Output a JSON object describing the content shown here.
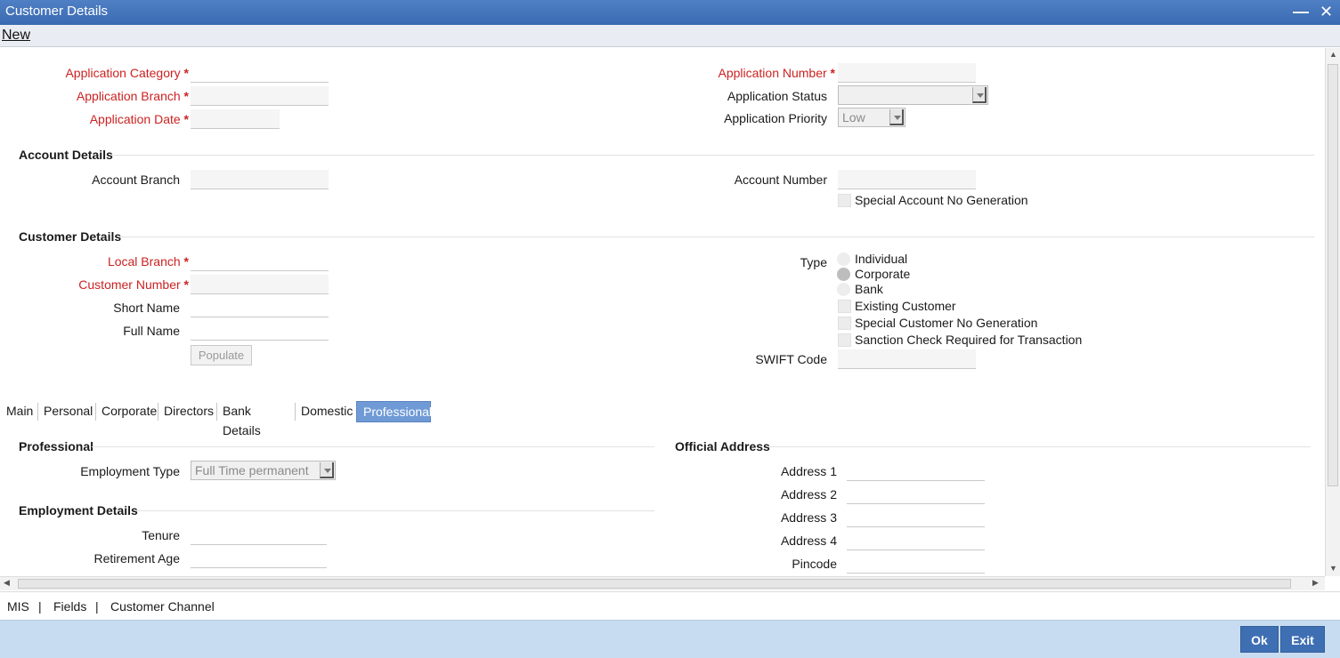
{
  "window": {
    "title": "Customer Details"
  },
  "menu": {
    "new_label": "New"
  },
  "application": {
    "category_label": "Application Category",
    "branch_label": "Application Branch",
    "date_label": "Application Date",
    "number_label": "Application Number",
    "status_label": "Application Status",
    "status_value": "",
    "priority_label": "Application Priority",
    "priority_value": "Low"
  },
  "account": {
    "section_title": "Account Details",
    "branch_label": "Account Branch",
    "number_label": "Account Number",
    "special_no_label": "Special Account No Generation"
  },
  "customer": {
    "section_title": "Customer Details",
    "local_branch_label": "Local Branch",
    "customer_number_label": "Customer Number",
    "short_name_label": "Short Name",
    "full_name_label": "Full Name",
    "populate_label": "Populate",
    "type_label": "Type",
    "type_options": [
      "Individual",
      "Corporate",
      "Bank"
    ],
    "type_selected": "Corporate",
    "existing_customer_label": "Existing Customer",
    "special_customer_no_label": "Special Customer No Generation",
    "sanction_check_label": "Sanction Check Required for Transaction",
    "swift_label": "SWIFT Code"
  },
  "tabs": [
    "Main",
    "Personal",
    "Corporate",
    "Directors",
    "Bank Details",
    "Domestic",
    "Professional"
  ],
  "active_tab": "Professional",
  "professional": {
    "section_title": "Professional",
    "employment_type_label": "Employment Type",
    "employment_type_value": "Full Time permanent",
    "employment_section_title": "Employment Details",
    "tenure_label": "Tenure",
    "retirement_age_label": "Retirement Age"
  },
  "official_address": {
    "section_title": "Official Address",
    "address1_label": "Address 1",
    "address2_label": "Address 2",
    "address3_label": "Address 3",
    "address4_label": "Address 4",
    "pincode_label": "Pincode"
  },
  "footer": {
    "links": [
      "MIS",
      "Fields",
      "Customer Channel"
    ],
    "separator": "|",
    "ok_label": "Ok",
    "exit_label": "Exit"
  },
  "icons": {
    "minimize": "minimize-icon",
    "close": "close-icon"
  },
  "colors": {
    "title_bar": "#3a6ab1",
    "required": "#cc2222",
    "active_tab": "#6f9ad6",
    "footer_bar": "#c7dcf0",
    "button": "#3f6fb3"
  }
}
